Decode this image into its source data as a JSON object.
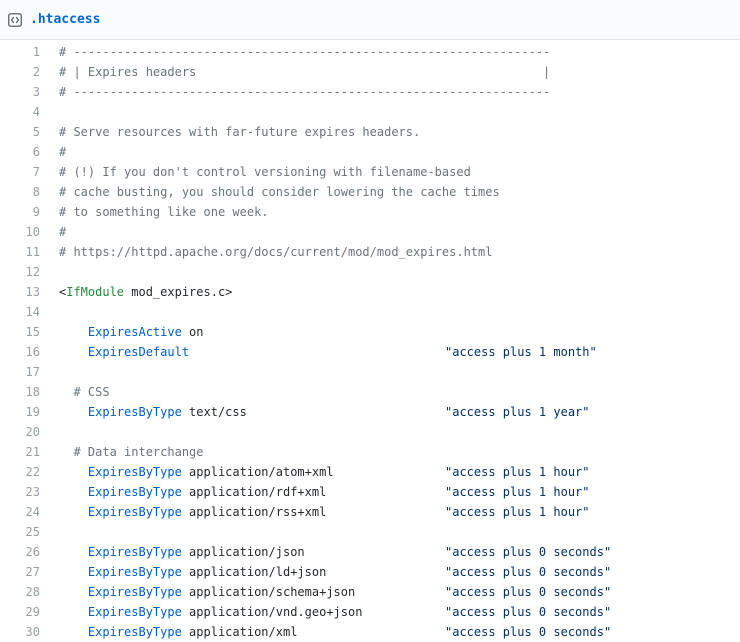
{
  "file": {
    "icon": "code-file-icon",
    "name": ".htaccess"
  },
  "colors": {
    "accent": "#0366d6",
    "comment": "#6a737d",
    "tag": "#22863a",
    "directive": "#005cc5",
    "string": "#032f62",
    "line_number": "#959da5"
  },
  "lines": [
    {
      "n": "1",
      "parts": [
        {
          "t": "cmt",
          "v": "# ------------------------------------------------------------------"
        }
      ]
    },
    {
      "n": "2",
      "parts": [
        {
          "t": "cmt",
          "v": "# | Expires headers                                                |"
        }
      ]
    },
    {
      "n": "3",
      "parts": [
        {
          "t": "cmt",
          "v": "# ------------------------------------------------------------------"
        }
      ]
    },
    {
      "n": "4",
      "parts": []
    },
    {
      "n": "5",
      "parts": [
        {
          "t": "cmt",
          "v": "# Serve resources with far-future expires headers."
        }
      ]
    },
    {
      "n": "6",
      "parts": [
        {
          "t": "cmt",
          "v": "#"
        }
      ]
    },
    {
      "n": "7",
      "parts": [
        {
          "t": "cmt",
          "v": "# (!) If you don't control versioning with filename-based"
        }
      ]
    },
    {
      "n": "8",
      "parts": [
        {
          "t": "cmt",
          "v": "# cache busting, you should consider lowering the cache times"
        }
      ]
    },
    {
      "n": "9",
      "parts": [
        {
          "t": "cmt",
          "v": "# to something like one week."
        }
      ]
    },
    {
      "n": "10",
      "parts": [
        {
          "t": "cmt",
          "v": "#"
        }
      ]
    },
    {
      "n": "11",
      "parts": [
        {
          "t": "cmt",
          "v": "# https://httpd.apache.org/docs/current/mod/mod_expires.html"
        }
      ]
    },
    {
      "n": "12",
      "parts": []
    },
    {
      "n": "13",
      "parts": [
        {
          "t": "plain",
          "v": "<"
        },
        {
          "t": "tag",
          "v": "IfModule"
        },
        {
          "t": "plain",
          "v": " mod_expires.c>"
        }
      ]
    },
    {
      "n": "14",
      "parts": []
    },
    {
      "n": "15",
      "parts": [
        {
          "t": "plain",
          "v": "    "
        },
        {
          "t": "dir",
          "v": "ExpiresActive"
        },
        {
          "t": "plain",
          "v": " on"
        }
      ]
    },
    {
      "n": "16",
      "parts": [
        {
          "t": "plain",
          "v": "    "
        },
        {
          "t": "dir",
          "v": "ExpiresDefault"
        }
      ],
      "value": "\"access plus 1 month\""
    },
    {
      "n": "17",
      "parts": []
    },
    {
      "n": "18",
      "parts": [
        {
          "t": "plain",
          "v": "  "
        },
        {
          "t": "cmt",
          "v": "# CSS"
        }
      ]
    },
    {
      "n": "19",
      "parts": [
        {
          "t": "plain",
          "v": "    "
        },
        {
          "t": "dir",
          "v": "ExpiresByType"
        },
        {
          "t": "plain",
          "v": " text/css"
        }
      ],
      "value": "\"access plus 1 year\""
    },
    {
      "n": "20",
      "parts": []
    },
    {
      "n": "21",
      "parts": [
        {
          "t": "plain",
          "v": "  "
        },
        {
          "t": "cmt",
          "v": "# Data interchange"
        }
      ]
    },
    {
      "n": "22",
      "parts": [
        {
          "t": "plain",
          "v": "    "
        },
        {
          "t": "dir",
          "v": "ExpiresByType"
        },
        {
          "t": "plain",
          "v": " application/atom+xml"
        }
      ],
      "value": "\"access plus 1 hour\""
    },
    {
      "n": "23",
      "parts": [
        {
          "t": "plain",
          "v": "    "
        },
        {
          "t": "dir",
          "v": "ExpiresByType"
        },
        {
          "t": "plain",
          "v": " application/rdf+xml"
        }
      ],
      "value": "\"access plus 1 hour\""
    },
    {
      "n": "24",
      "parts": [
        {
          "t": "plain",
          "v": "    "
        },
        {
          "t": "dir",
          "v": "ExpiresByType"
        },
        {
          "t": "plain",
          "v": " application/rss+xml"
        }
      ],
      "value": "\"access plus 1 hour\""
    },
    {
      "n": "25",
      "parts": []
    },
    {
      "n": "26",
      "parts": [
        {
          "t": "plain",
          "v": "    "
        },
        {
          "t": "dir",
          "v": "ExpiresByType"
        },
        {
          "t": "plain",
          "v": " application/json"
        }
      ],
      "value": "\"access plus 0 seconds\""
    },
    {
      "n": "27",
      "parts": [
        {
          "t": "plain",
          "v": "    "
        },
        {
          "t": "dir",
          "v": "ExpiresByType"
        },
        {
          "t": "plain",
          "v": " application/ld+json"
        }
      ],
      "value": "\"access plus 0 seconds\""
    },
    {
      "n": "28",
      "parts": [
        {
          "t": "plain",
          "v": "    "
        },
        {
          "t": "dir",
          "v": "ExpiresByType"
        },
        {
          "t": "plain",
          "v": " application/schema+json"
        }
      ],
      "value": "\"access plus 0 seconds\""
    },
    {
      "n": "29",
      "parts": [
        {
          "t": "plain",
          "v": "    "
        },
        {
          "t": "dir",
          "v": "ExpiresByType"
        },
        {
          "t": "plain",
          "v": " application/vnd.geo+json"
        }
      ],
      "value": "\"access plus 0 seconds\""
    },
    {
      "n": "30",
      "parts": [
        {
          "t": "plain",
          "v": "    "
        },
        {
          "t": "dir",
          "v": "ExpiresByType"
        },
        {
          "t": "plain",
          "v": " application/xml"
        }
      ],
      "value": "\"access plus 0 seconds\""
    }
  ]
}
